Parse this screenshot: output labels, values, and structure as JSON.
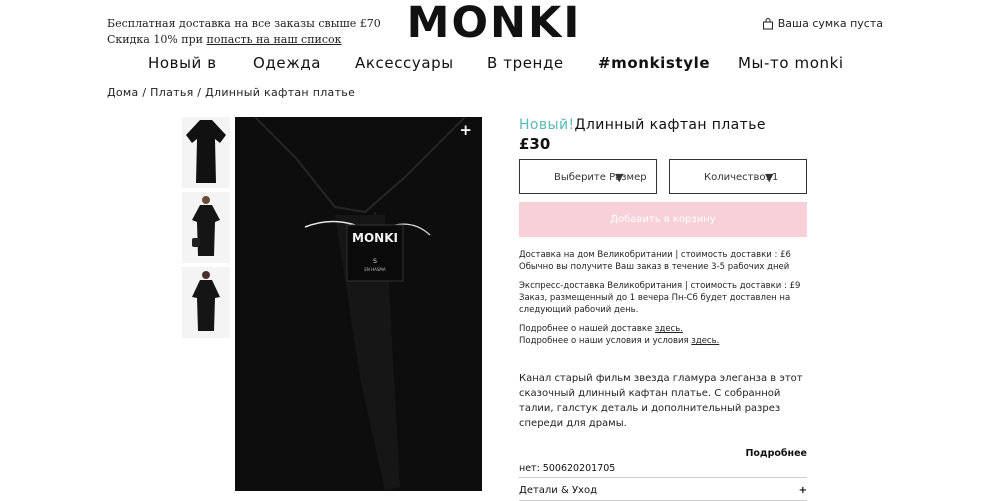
{
  "topbar": {
    "free_shipping": "Бесплатная доставка на все заказы свыше £70",
    "discount_prefix": "Скидка 10% при ",
    "discount_link": "попасть на наш список",
    "cart_label": "Ваша сумка пуста"
  },
  "logo": {
    "text": "MONKI"
  },
  "nav": {
    "items": [
      "Новый в",
      "Одежда",
      "Аксессуары",
      "В тренде",
      "#monkistyle",
      "Мы-то monki"
    ]
  },
  "breadcrumb": {
    "text": "Дома / Платья / Длинный кафтан платье"
  },
  "product": {
    "badge": "Новый!",
    "title": "Длинный кафтан платье",
    "price": "£30",
    "size_label": "Выберите Размер",
    "qty_label": "Количество: 1",
    "add_button": "Добавить в корзину",
    "label_brand": "MONKI",
    "label_size": "S",
    "label_fine": "EN HASMA"
  },
  "shipping": {
    "home_line1": "Доставка на дом Великобритании | стоимость доставки : £6",
    "home_line2": "Обычно вы получите Ваш заказ в течение 3-5 рабочих дней",
    "exp_line1": "Экспресс-доставка Великобритания | стоимость доставки : £9",
    "exp_line2": "Заказ, размещенный до 1 вечера Пн-Сб будет доставлен на",
    "exp_line3": "следующий рабочий день.",
    "more_delivery": "Подробнее о нашей доставке ",
    "more_terms": "Подробнее о наши условия и условия ",
    "here": "здесь."
  },
  "description": "Канал старый фильм звезда гламура элеганза в этот сказочный длинный кафтан платье. С собранной талии, галстук деталь и дополнительный разрез спереди для драмы.",
  "more_link": "Подробнее",
  "article": "нет: 500620201705",
  "details": {
    "label": "Детали & Уход",
    "toggle": "+"
  },
  "colors": {
    "accent": "#5ab9b9",
    "button_bg": "#f8d0d8",
    "image_bg": "#0d0d0d"
  }
}
